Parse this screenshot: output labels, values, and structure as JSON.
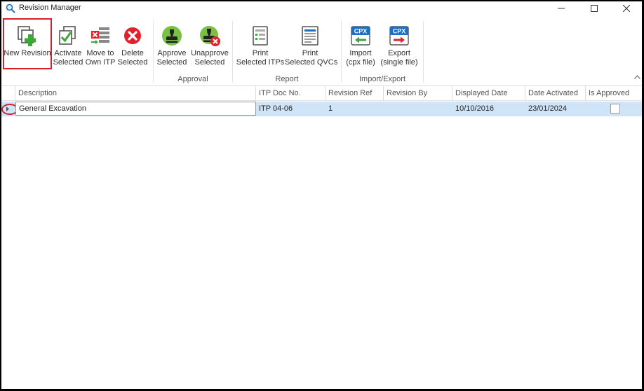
{
  "window": {
    "title": "Revision Manager",
    "icon": "magnifier-icon"
  },
  "toolbar": {
    "new_revision": "New Revision",
    "activate": [
      "Activate",
      "Selected"
    ],
    "move_to": [
      "Move to",
      "Own ITP"
    ],
    "delete": [
      "Delete",
      "Selected"
    ],
    "approve": [
      "Approve",
      "Selected"
    ],
    "unapprove": [
      "Unapprove",
      "Selected"
    ],
    "print_itps": [
      "Print",
      "Selected ITPs"
    ],
    "print_qvcs": [
      "Print",
      "Selected QVCs"
    ],
    "import": [
      "Import",
      "(cpx file)"
    ],
    "export": [
      "Export",
      "(single file)"
    ]
  },
  "groups": {
    "approval": "Approval",
    "report": "Report",
    "import_export": "Import/Export"
  },
  "icons": {
    "cpx_text": "CPX"
  },
  "grid": {
    "columns": [
      "Description",
      "ITP Doc No.",
      "Revision Ref",
      "Revision By",
      "Displayed Date",
      "Date Activated",
      "Is Approved"
    ],
    "rows": [
      {
        "description": "General Excavation",
        "itp_doc_no": "ITP 04-06",
        "revision_ref": "1",
        "revision_by": "",
        "displayed_date": "10/10/2016",
        "date_activated": "23/01/2024",
        "is_approved": false
      }
    ]
  },
  "colors": {
    "selection": "#cfe4f7",
    "highlight": "#d6202a",
    "green": "#3aa935",
    "red": "#e2212b",
    "blue": "#1b6fc6"
  }
}
